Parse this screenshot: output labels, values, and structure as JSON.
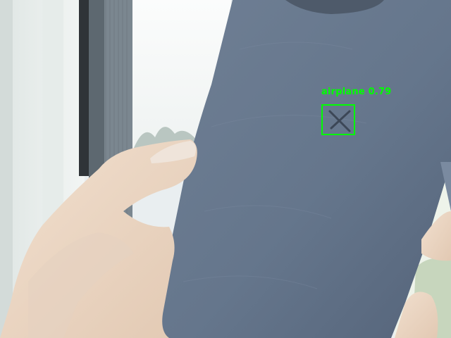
{
  "detection": {
    "label": "airplane",
    "score": "0.79",
    "color": "#00ff00"
  },
  "scene": {
    "description_icons": [
      "window-frame",
      "phone-case",
      "hand",
      "x-mark-on-case"
    ]
  }
}
